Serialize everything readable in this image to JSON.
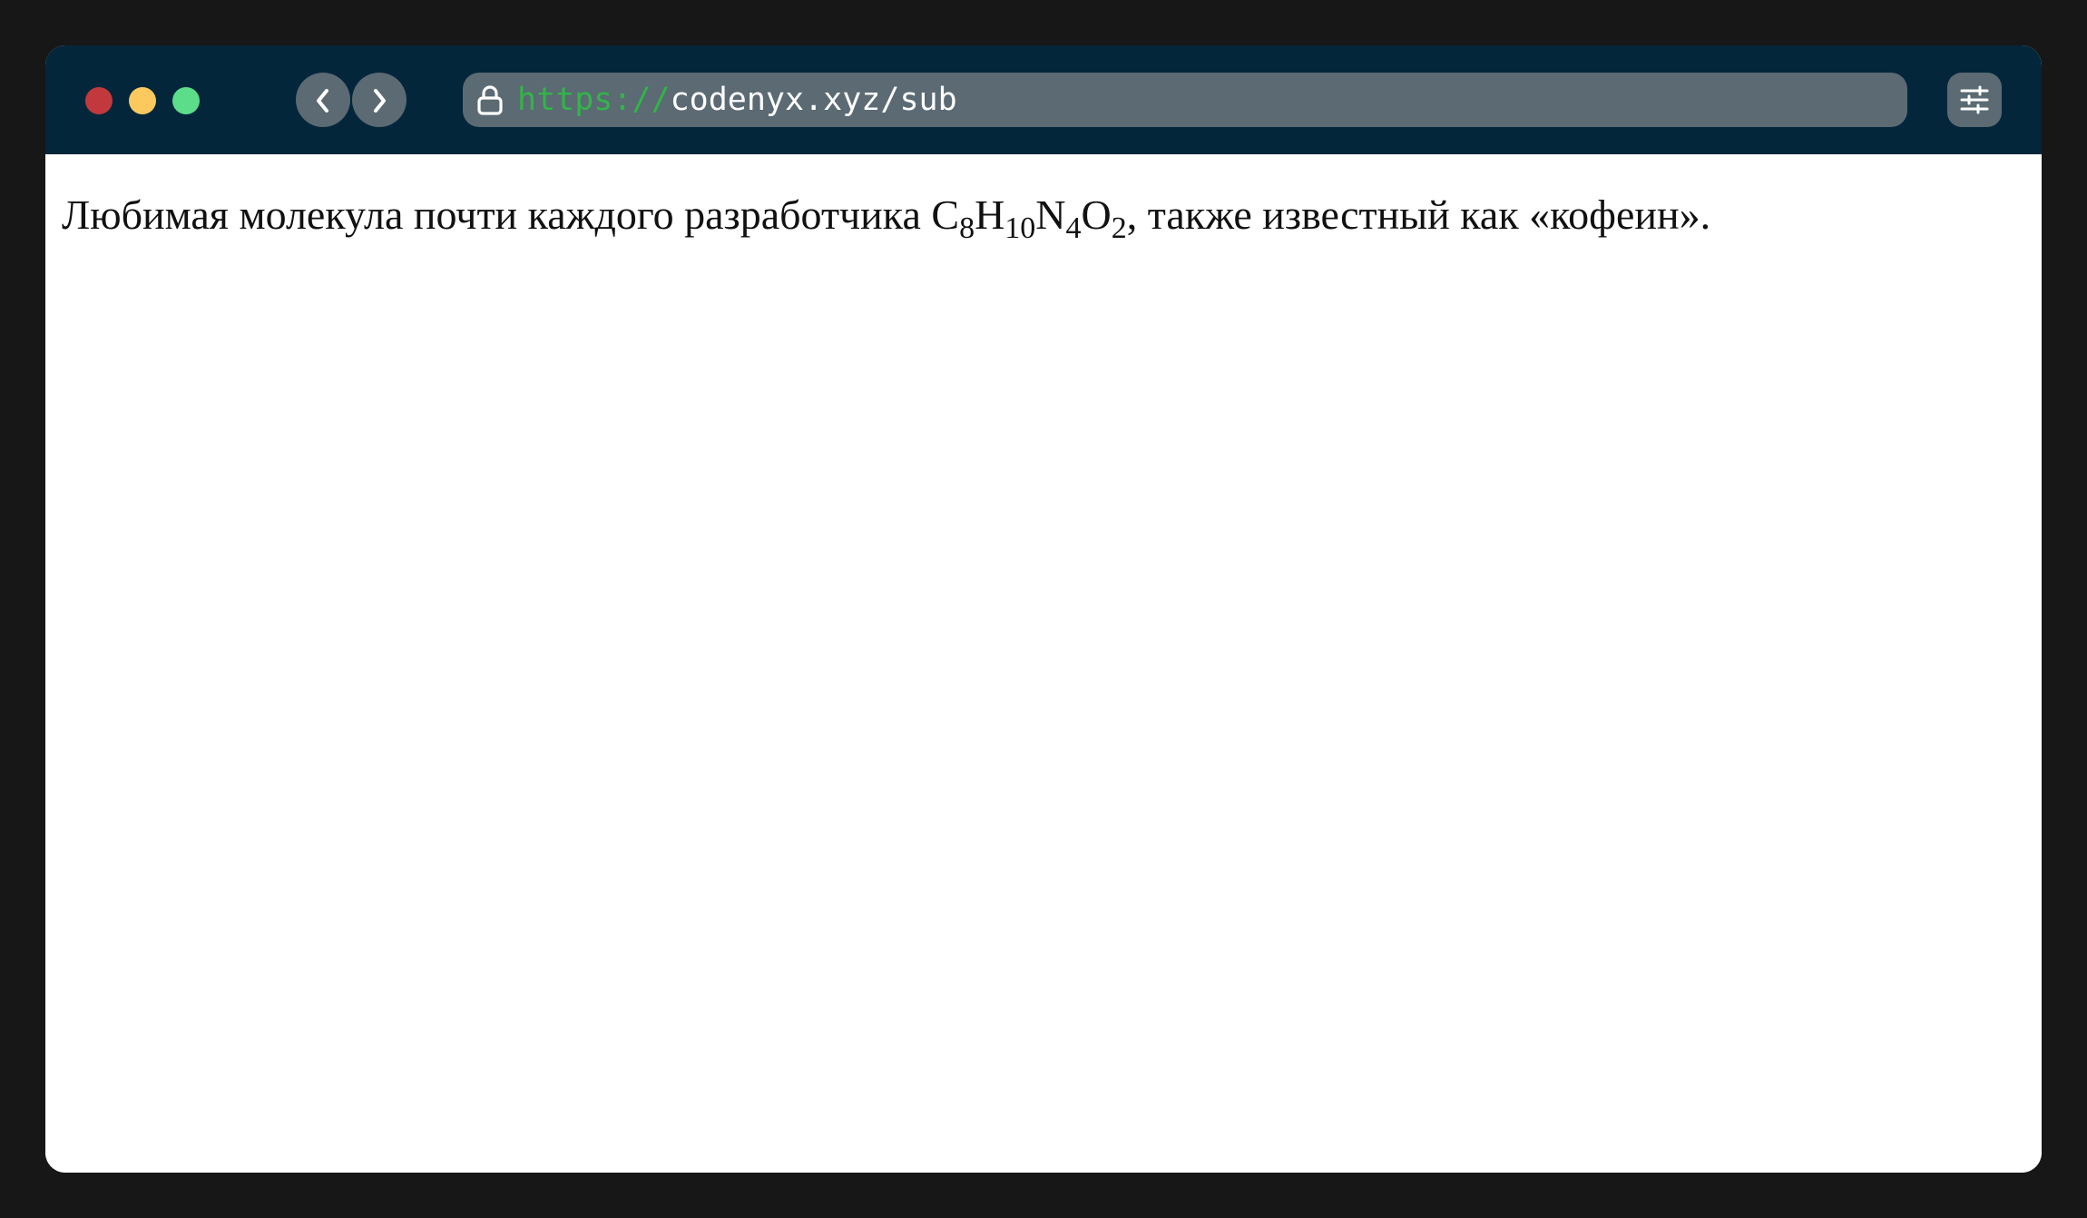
{
  "window": {
    "controls": [
      "close",
      "minimize",
      "maximize"
    ],
    "colors": {
      "titlebar": "#03263b",
      "close": "#c1393c",
      "minimize": "#fcc95f",
      "maximize": "#5bdd8a",
      "url_scheme": "#32b449"
    }
  },
  "toolbar": {
    "back_icon": "chevron-left-icon",
    "forward_icon": "chevron-right-icon",
    "lock_icon": "lock-icon",
    "settings_icon": "sliders-icon"
  },
  "address": {
    "scheme": "https://",
    "rest": "codenyx.xyz/sub"
  },
  "content": {
    "before": "Любимая молекула почти каждого разработчика ",
    "formula": [
      {
        "element": "C",
        "count": "8"
      },
      {
        "element": "H",
        "count": "10"
      },
      {
        "element": "N",
        "count": "4"
      },
      {
        "element": "O",
        "count": "2"
      }
    ],
    "after": ", также известный как «кофеин»."
  }
}
